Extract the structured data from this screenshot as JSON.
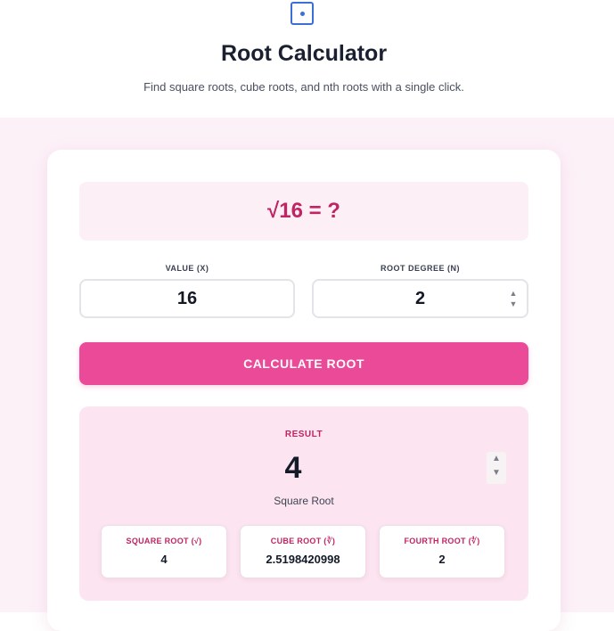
{
  "header": {
    "title": "Root Calculator",
    "subtitle": "Find square roots, cube roots, and nth roots with a single click."
  },
  "equation": "√16 = ?",
  "inputs": {
    "value_label": "VALUE (X)",
    "value": "16",
    "degree_label": "ROOT DEGREE (N)",
    "degree": "2"
  },
  "button": {
    "label": "CALCULATE ROOT"
  },
  "result": {
    "label": "RESULT",
    "value": "4",
    "type": "Square Root",
    "roots": [
      {
        "label": "SQUARE ROOT (√)",
        "value": "4"
      },
      {
        "label": "CUBE ROOT (∛)",
        "value": "2.5198420998"
      },
      {
        "label": "FOURTH ROOT (∜)",
        "value": "2"
      }
    ]
  },
  "colors": {
    "accent": "#eb4a98",
    "accent_text": "#c02463",
    "logo": "#3b6fd6",
    "page_background": "#fdf1f8"
  },
  "icons": {
    "logo": "die-icon",
    "spinner": "spin-arrows-icon"
  }
}
